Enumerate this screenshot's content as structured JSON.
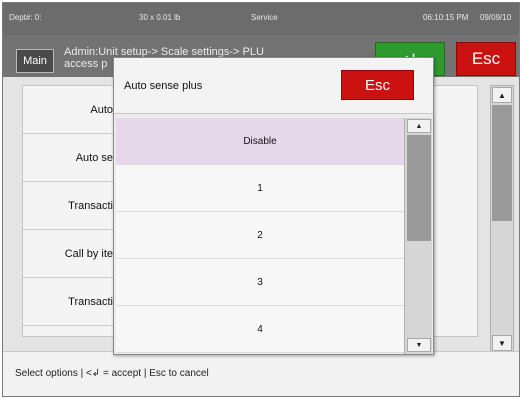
{
  "status": {
    "dept": "Dept#: 0:",
    "weight": "30 x 0.01 lb",
    "mode": "Service",
    "time": "06:10:15 PM",
    "date": "09/09/10"
  },
  "header": {
    "main_label": "Main",
    "breadcrumb_line1": "Admin:Unit setup-> Scale settings-> PLU",
    "breadcrumb_line2": "access p",
    "enter_icon": "↵",
    "esc_label": "Esc"
  },
  "settings": [
    {
      "label": "Auto"
    },
    {
      "label": "Auto se"
    },
    {
      "label": "Transacti"
    },
    {
      "label": "Call by ite"
    },
    {
      "label": "Transacti"
    }
  ],
  "modal": {
    "title": "Auto sense plus",
    "esc_label": "Esc",
    "options": [
      {
        "label": "Disable",
        "selected": true
      },
      {
        "label": "1",
        "selected": false
      },
      {
        "label": "2",
        "selected": false
      },
      {
        "label": "3",
        "selected": false
      },
      {
        "label": "4",
        "selected": false
      }
    ]
  },
  "scroll": {
    "up_icon": "▲",
    "down_icon": "▼"
  },
  "hint": "Select options | <↲ = accept | Esc to cancel",
  "colors": {
    "esc_red": "#cc1111",
    "enter_green": "#2e9a2e",
    "selected_option": "#e6d8ea"
  }
}
